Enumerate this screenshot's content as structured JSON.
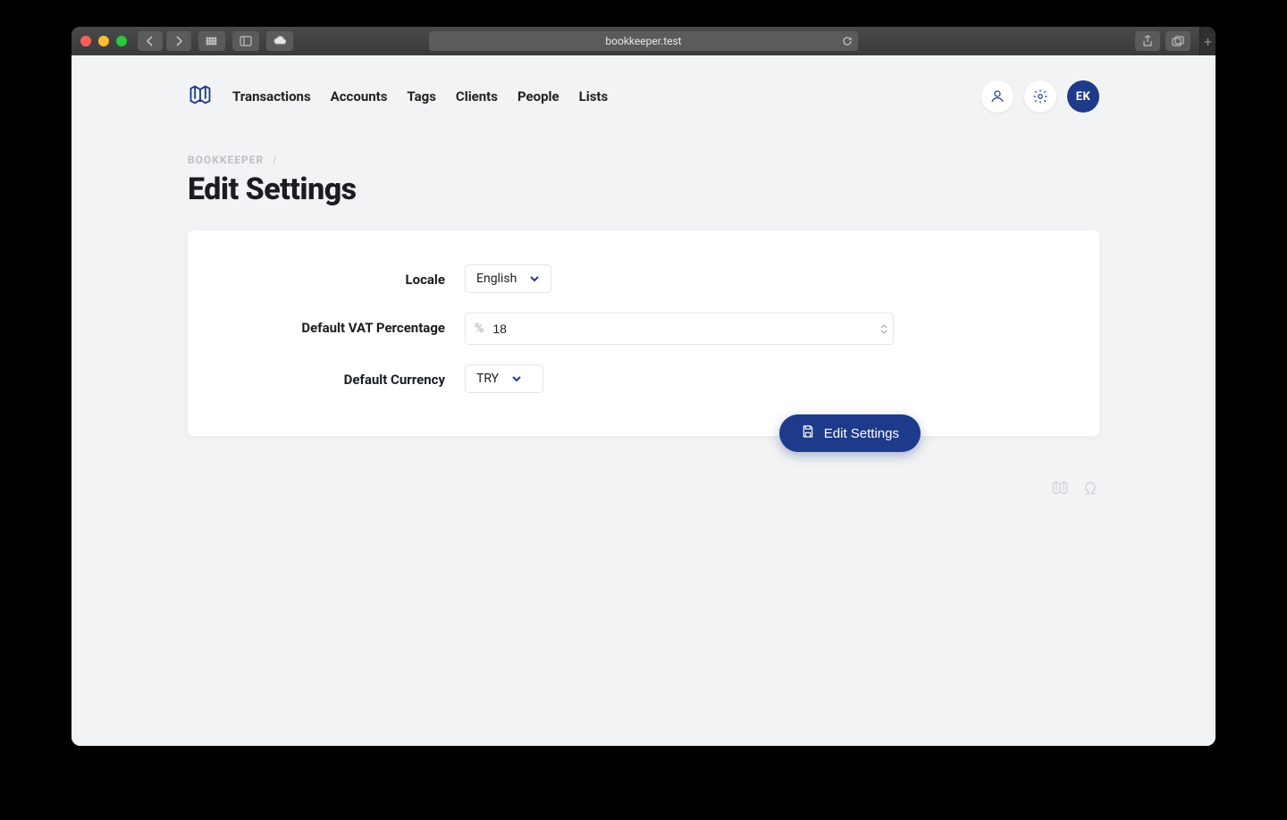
{
  "browser": {
    "address": "bookkeeper.test"
  },
  "nav": {
    "items": [
      "Transactions",
      "Accounts",
      "Tags",
      "Clients",
      "People",
      "Lists"
    ],
    "avatar_initials": "EK"
  },
  "breadcrumb": {
    "root": "BOOKKEEPER",
    "sep": "/"
  },
  "page_title": "Edit Settings",
  "form": {
    "locale": {
      "label": "Locale",
      "value": "English"
    },
    "vat": {
      "label": "Default VAT Percentage",
      "prefix": "%",
      "value": "18"
    },
    "currency": {
      "label": "Default Currency",
      "value": "TRY"
    }
  },
  "submit_label": "Edit Settings"
}
